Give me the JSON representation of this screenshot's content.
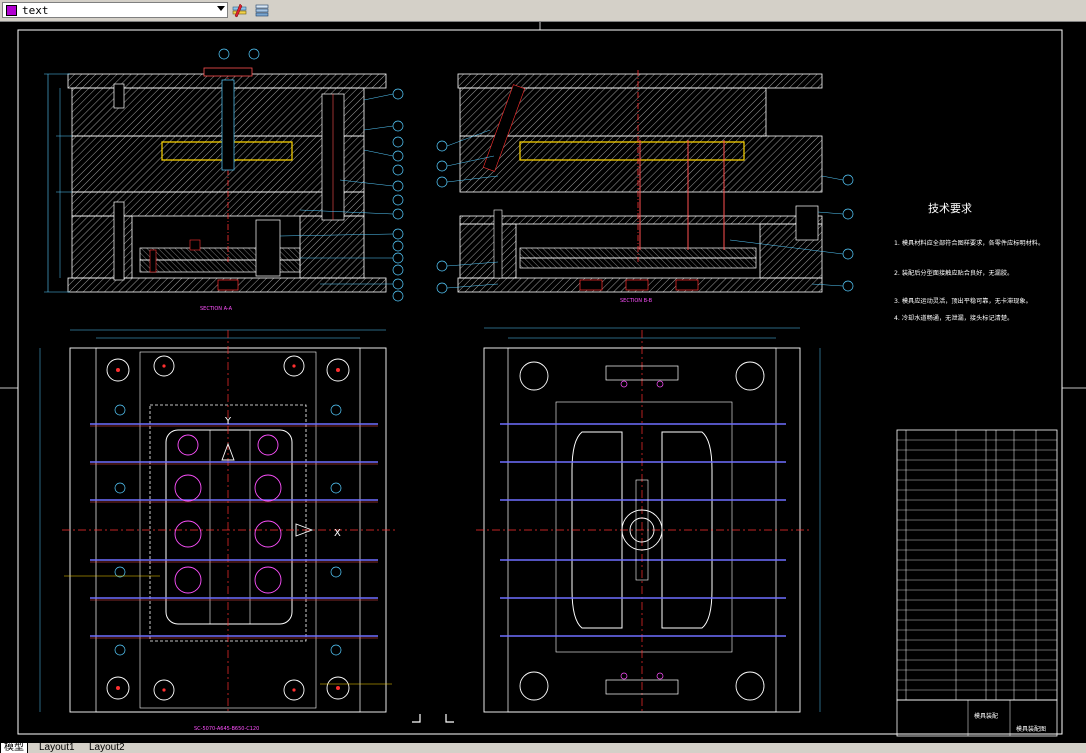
{
  "toolbar": {
    "layer_name": "text",
    "layer_color": "#b000d0"
  },
  "drawing": {
    "section_left_label": "SECTION A-A",
    "section_right_label": "SECTION B-B",
    "tech_title": "技术要求",
    "tech_lines": [
      "1. 模具材料应全部符合图样要求，各零件应标明材料。",
      "2. 装配后分型面接触应贴合良好，无漏胶。",
      "3. 模具应运动灵活，顶出平稳可靠，无卡滞现象。",
      "4. 冷却水道畅通，无泄漏，接头标记清楚。"
    ],
    "bottom_note": "SC-5070-A645-B650-C120",
    "title_block_left": "模具装配",
    "title_block_right": "模具装配图",
    "axis_y": "Y",
    "axis_x": "X"
  },
  "tabs": [
    {
      "label": "模型",
      "active": true
    },
    {
      "label": "Layout1",
      "active": false
    },
    {
      "label": "Layout2",
      "active": false
    }
  ]
}
